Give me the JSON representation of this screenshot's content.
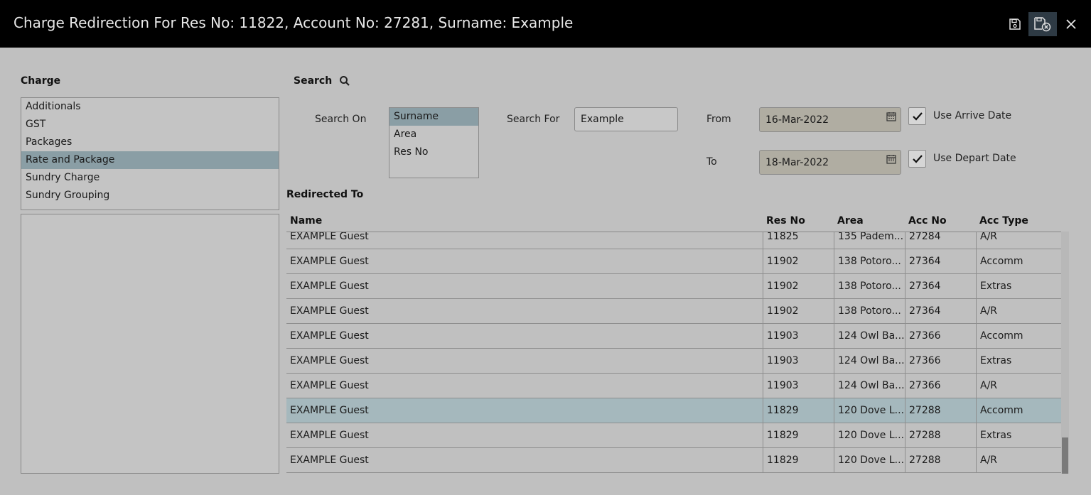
{
  "window": {
    "title": "Charge Redirection For Res No: 11822, Account No: 27281, Surname: Example",
    "buttons": {
      "save": "save-icon",
      "save_close": "save-close-icon",
      "close": "close-icon"
    }
  },
  "charge": {
    "heading": "Charge",
    "items": [
      "Additionals",
      "GST",
      "Packages",
      "Rate and Package",
      "Sundry Charge",
      "Sundry Grouping"
    ],
    "selected": "Rate and Package"
  },
  "search": {
    "heading": "Search",
    "search_on_label": "Search On",
    "search_on_options": [
      "Surname",
      "Area",
      "Res No"
    ],
    "search_on_selected": "Surname",
    "search_for_label": "Search For",
    "search_for_value": "Example",
    "from_label": "From",
    "from_value": "16-Mar-2022",
    "to_label": "To",
    "to_value": "18-Mar-2022",
    "use_arrive_label": "Use Arrive Date",
    "use_arrive_checked": true,
    "use_depart_label": "Use Depart Date",
    "use_depart_checked": true
  },
  "redirected": {
    "heading": "Redirected To",
    "columns": [
      "Name",
      "Res No",
      "Area",
      "Acc No",
      "Acc Type"
    ],
    "rows": [
      [
        "EXAMPLE Guest",
        "11825",
        "135 Padem...",
        "27284",
        "A/R"
      ],
      [
        "EXAMPLE Guest",
        "11902",
        "138 Potoro...",
        "27364",
        "Accomm"
      ],
      [
        "EXAMPLE Guest",
        "11902",
        "138 Potoro...",
        "27364",
        "Extras"
      ],
      [
        "EXAMPLE Guest",
        "11902",
        "138 Potoro...",
        "27364",
        "A/R"
      ],
      [
        "EXAMPLE Guest",
        "11903",
        "124 Owl Ba...",
        "27366",
        "Accomm"
      ],
      [
        "EXAMPLE Guest",
        "11903",
        "124 Owl Ba...",
        "27366",
        "Extras"
      ],
      [
        "EXAMPLE Guest",
        "11903",
        "124 Owl Ba...",
        "27366",
        "A/R"
      ],
      [
        "EXAMPLE Guest",
        "11829",
        "120 Dove L...",
        "27288",
        "Accomm"
      ],
      [
        "EXAMPLE Guest",
        "11829",
        "120 Dove L...",
        "27288",
        "Extras"
      ],
      [
        "EXAMPLE Guest",
        "11829",
        "120 Dove L...",
        "27288",
        "A/R"
      ]
    ],
    "selected_row": 7
  }
}
